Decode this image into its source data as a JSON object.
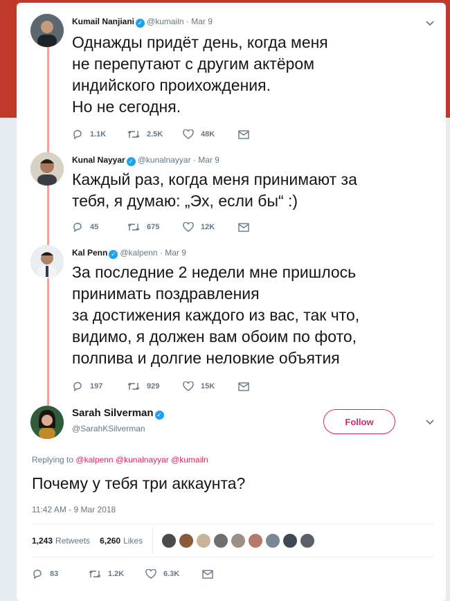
{
  "colors": {
    "accent": "#e0245e",
    "thread_line": "#f2a2a2",
    "verified": "#1da1f2",
    "muted": "#657786"
  },
  "tweets": [
    {
      "name": "Kumail Nanjiani",
      "handle": "@kumailn",
      "date": "· Mar 9",
      "text": "Однажды придёт день, когда меня\nне перепутают с другим актёром\nиндийского проихождения.\nНо не сегодня.",
      "replies": "1.1K",
      "retweets": "2.5K",
      "likes": "48K"
    },
    {
      "name": "Kunal Nayyar",
      "handle": "@kunalnayyar",
      "date": "· Mar 9",
      "text": "Каждый раз, когда меня принимают за\nтебя, я думаю: „Эх, если бы“ :)",
      "replies": "45",
      "retweets": "675",
      "likes": "12K"
    },
    {
      "name": "Kal Penn",
      "handle": "@kalpenn",
      "date": "· Mar 9",
      "text": "За последние 2 недели мне пришлось\nпринимать поздравления\nза достижения каждого из вас, так что,\nвидимо, я должен вам обоим по фото,\nполпива и долгие неловкие объятия",
      "replies": "197",
      "retweets": "929",
      "likes": "15K"
    }
  ],
  "main": {
    "name": "Sarah Silverman",
    "handle": "@SarahKSilverman",
    "follow_label": "Follow",
    "replying_prefix": "Replying to",
    "replying_to": "@kalpenn @kunalnayyar @kumailn",
    "text": "Почему у тебя три аккаунта?",
    "timestamp": "11:42 AM - 9 Mar 2018",
    "retweets_count": "1,243",
    "retweets_label": "Retweets",
    "likes_count": "6,260",
    "likes_label": "Likes",
    "replies": "83",
    "retweets": "1.2K",
    "likes": "6.3K"
  }
}
